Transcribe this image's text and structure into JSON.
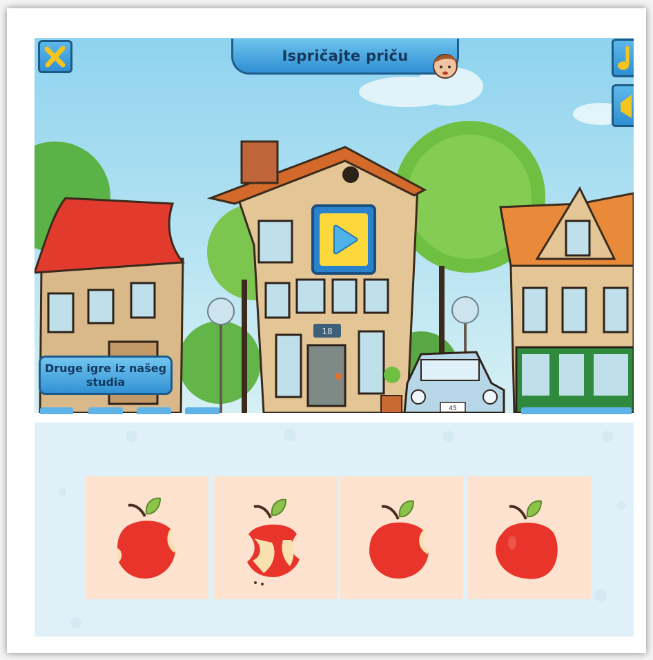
{
  "game": {
    "title": "Ispričajte priču",
    "other_games_label": "Druge igre iz našeg studia",
    "house_number": "18",
    "plate": "45"
  },
  "cards": [
    {
      "icon": "apple-two-bites-icon",
      "bites": 2
    },
    {
      "icon": "apple-core-icon",
      "bites": 3
    },
    {
      "icon": "apple-one-bite-icon",
      "bites": 1
    },
    {
      "icon": "apple-whole-icon",
      "bites": 0
    }
  ],
  "colors": {
    "banner_blue": "#2f8fd3",
    "sky": "#aee0f1",
    "card_bg": "#fde3cf",
    "apple_red": "#e8342a"
  }
}
